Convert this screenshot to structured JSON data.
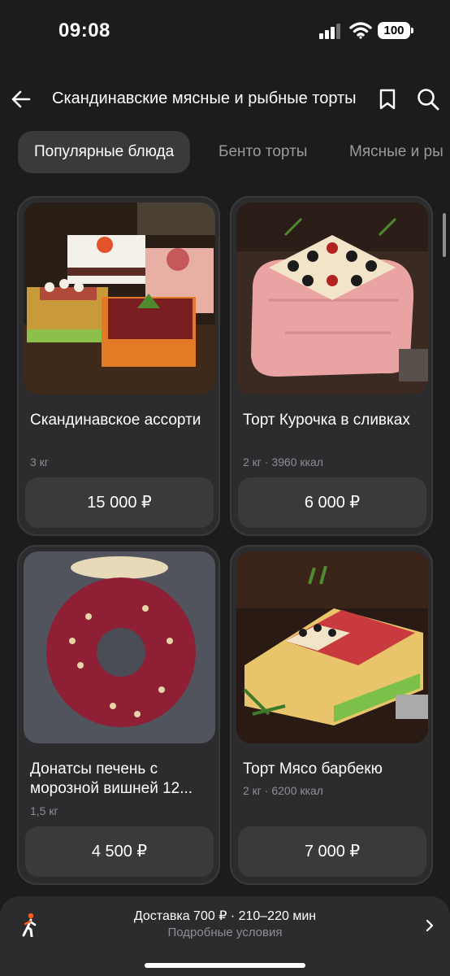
{
  "status_bar": {
    "time": "09:08",
    "battery": "100"
  },
  "header": {
    "title": "Скандинавские мясные и рыбные торты"
  },
  "tabs": [
    {
      "label": "Популярные блюда",
      "active": true
    },
    {
      "label": "Бенто торты",
      "active": false
    },
    {
      "label": "Мясные и ры",
      "active": false
    }
  ],
  "products": [
    {
      "name": "Скандинавское ассорти",
      "meta": "3 кг",
      "price": "15 000 ₽"
    },
    {
      "name": "Торт Курочка в сливках",
      "meta": "2 кг · 3960 ккал",
      "price": "6 000 ₽"
    },
    {
      "name": "Донатсы печень с морозной вишней 12...",
      "meta": "1,5 кг",
      "price": "4 500 ₽"
    },
    {
      "name": "Торт Мясо барбекю",
      "meta": "2 кг · 6200 ккал",
      "price": "7 000 ₽"
    }
  ],
  "delivery": {
    "main": "Доставка 700 ₽ · 210–220 мин",
    "sub": "Подробные условия"
  },
  "colors": {
    "background": "#1c1c1d",
    "card": "#2c2c2e",
    "button": "#3a3a3c",
    "muted": "#8e8e93"
  }
}
